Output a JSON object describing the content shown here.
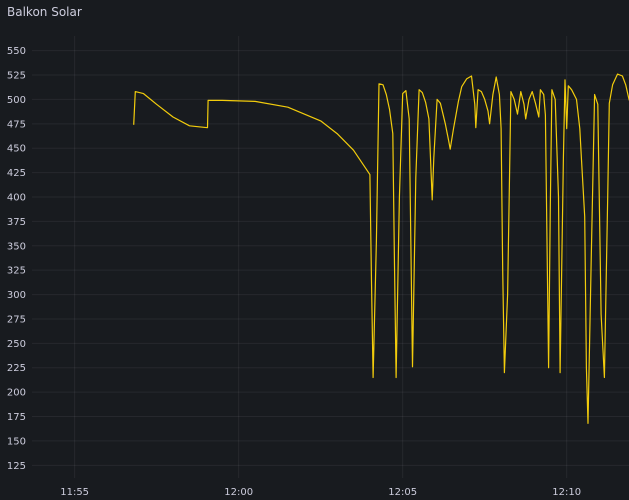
{
  "panel": {
    "title": "Balkon Solar"
  },
  "chart_data": {
    "type": "line",
    "title": "",
    "xlabel": "",
    "ylabel": "",
    "x_ticks": [
      "11:55",
      "12:00",
      "12:05",
      "12:10"
    ],
    "x_tick_minutes": [
      -5,
      0,
      5,
      10
    ],
    "xlim_minutes": [
      -6.3,
      11.9
    ],
    "y_ticks": [
      125,
      150,
      175,
      200,
      225,
      250,
      275,
      300,
      325,
      350,
      375,
      400,
      425,
      450,
      475,
      500,
      525,
      550
    ],
    "ylim": [
      112,
      565
    ],
    "grid": true,
    "legend": "none",
    "series": [
      {
        "color": "#f2cc0c",
        "points": [
          [
            -3.2,
            474
          ],
          [
            -3.15,
            508
          ],
          [
            -2.9,
            506
          ],
          [
            -2.5,
            495
          ],
          [
            -2.0,
            482
          ],
          [
            -1.5,
            473
          ],
          [
            -0.95,
            471
          ],
          [
            -0.93,
            499
          ],
          [
            -0.5,
            499
          ],
          [
            0.5,
            498
          ],
          [
            1.5,
            492
          ],
          [
            2.5,
            478
          ],
          [
            3.0,
            465
          ],
          [
            3.5,
            448
          ],
          [
            4.0,
            423
          ],
          [
            4.05,
            313
          ],
          [
            4.1,
            215
          ],
          [
            4.2,
            355
          ],
          [
            4.28,
            516
          ],
          [
            4.4,
            515
          ],
          [
            4.5,
            505
          ],
          [
            4.6,
            490
          ],
          [
            4.7,
            465
          ],
          [
            4.75,
            330
          ],
          [
            4.8,
            215
          ],
          [
            4.9,
            400
          ],
          [
            5.0,
            506
          ],
          [
            5.1,
            509
          ],
          [
            5.2,
            480
          ],
          [
            5.3,
            226
          ],
          [
            5.4,
            420
          ],
          [
            5.5,
            510
          ],
          [
            5.6,
            507
          ],
          [
            5.7,
            497
          ],
          [
            5.8,
            480
          ],
          [
            5.9,
            397
          ],
          [
            5.95,
            440
          ],
          [
            6.05,
            500
          ],
          [
            6.15,
            496
          ],
          [
            6.3,
            475
          ],
          [
            6.4,
            458
          ],
          [
            6.45,
            449
          ],
          [
            6.55,
            470
          ],
          [
            6.7,
            498
          ],
          [
            6.8,
            513
          ],
          [
            6.95,
            521
          ],
          [
            7.1,
            524
          ],
          [
            7.2,
            495
          ],
          [
            7.23,
            471
          ],
          [
            7.3,
            510
          ],
          [
            7.4,
            508
          ],
          [
            7.5,
            500
          ],
          [
            7.6,
            488
          ],
          [
            7.65,
            475
          ],
          [
            7.75,
            505
          ],
          [
            7.85,
            523
          ],
          [
            7.95,
            505
          ],
          [
            8.0,
            470
          ],
          [
            8.05,
            325
          ],
          [
            8.1,
            220
          ],
          [
            8.2,
            300
          ],
          [
            8.3,
            508
          ],
          [
            8.4,
            500
          ],
          [
            8.5,
            485
          ],
          [
            8.6,
            508
          ],
          [
            8.7,
            495
          ],
          [
            8.75,
            480
          ],
          [
            8.85,
            500
          ],
          [
            8.95,
            508
          ],
          [
            9.05,
            496
          ],
          [
            9.15,
            482
          ],
          [
            9.2,
            510
          ],
          [
            9.3,
            505
          ],
          [
            9.35,
            484
          ],
          [
            9.45,
            225
          ],
          [
            9.5,
            390
          ],
          [
            9.55,
            510
          ],
          [
            9.65,
            500
          ],
          [
            9.75,
            400
          ],
          [
            9.8,
            220
          ],
          [
            9.9,
            440
          ],
          [
            9.95,
            520
          ],
          [
            10.0,
            470
          ],
          [
            10.05,
            514
          ],
          [
            10.15,
            510
          ],
          [
            10.3,
            500
          ],
          [
            10.4,
            470
          ],
          [
            10.45,
            440
          ],
          [
            10.55,
            380
          ],
          [
            10.6,
            225
          ],
          [
            10.65,
            168
          ],
          [
            10.75,
            340
          ],
          [
            10.85,
            505
          ],
          [
            10.95,
            495
          ],
          [
            11.05,
            280
          ],
          [
            11.15,
            215
          ],
          [
            11.25,
            400
          ],
          [
            11.3,
            496
          ],
          [
            11.4,
            515
          ],
          [
            11.55,
            526
          ],
          [
            11.7,
            524
          ],
          [
            11.8,
            515
          ],
          [
            11.9,
            500
          ],
          [
            12.0,
            492
          ]
        ]
      }
    ]
  }
}
